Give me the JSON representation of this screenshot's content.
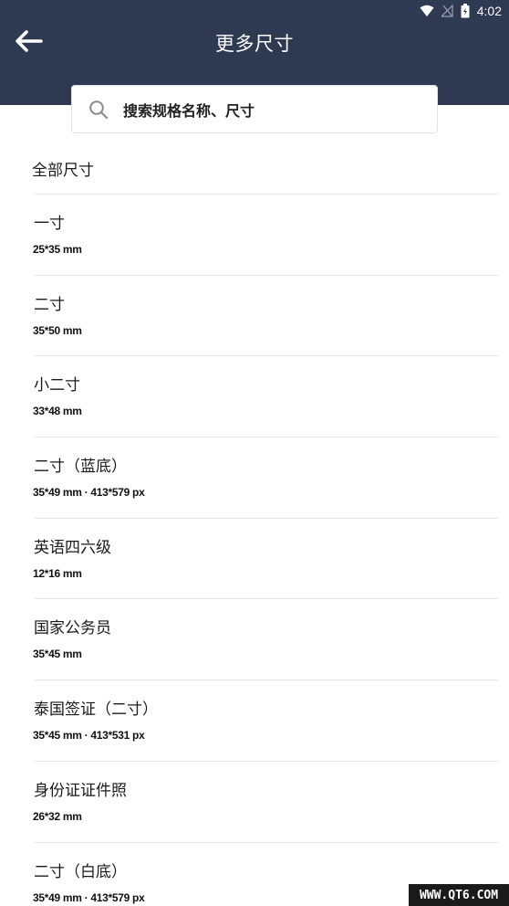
{
  "status_bar": {
    "time": "4:02",
    "icons": [
      "wifi-icon",
      "signal-icon",
      "battery-icon"
    ]
  },
  "header": {
    "title": "更多尺寸",
    "back_icon": "arrow-left-icon",
    "background": "#2e3a51"
  },
  "search": {
    "placeholder": "搜索规格名称、尺寸",
    "icon": "search-icon"
  },
  "section_title": "全部尺寸",
  "items": [
    {
      "name": "一寸",
      "dims": "25*35 mm"
    },
    {
      "name": "二寸",
      "dims": "35*50 mm"
    },
    {
      "name": "小二寸",
      "dims": "33*48 mm"
    },
    {
      "name": "二寸（蓝底）",
      "dims": "35*49 mm · 413*579 px"
    },
    {
      "name": "英语四六级",
      "dims": "12*16 mm"
    },
    {
      "name": "国家公务员",
      "dims": "35*45 mm"
    },
    {
      "name": "泰国签证（二寸）",
      "dims": "35*45 mm · 413*531 px"
    },
    {
      "name": "身份证证件照",
      "dims": "26*32 mm"
    },
    {
      "name": "二寸（白底）",
      "dims": "35*49 mm · 413*579 px"
    }
  ],
  "watermark": "WWW.QT6.COM"
}
